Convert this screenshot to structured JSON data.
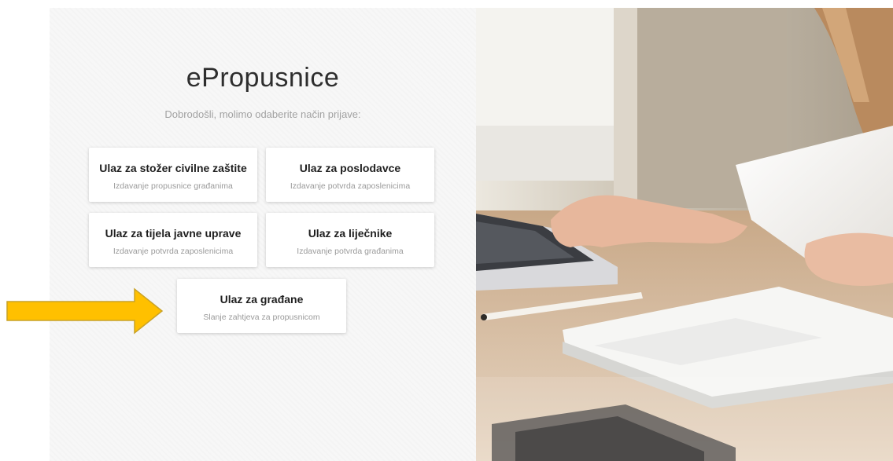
{
  "app": {
    "title": "ePropusnice",
    "subtitle": "Dobrodošli, molimo odaberite način prijave:"
  },
  "cards": [
    {
      "title": "Ulaz za stožer civilne zaštite",
      "subtitle": "Izdavanje propusnice građanima"
    },
    {
      "title": "Ulaz za poslodavce",
      "subtitle": "Izdavanje potvrda zaposlenicima"
    },
    {
      "title": "Ulaz za tijela javne uprave",
      "subtitle": "Izdavanje potvrda zaposlenicima"
    },
    {
      "title": "Ulaz za liječnike",
      "subtitle": "Izdavanje potvrda građanima"
    },
    {
      "title": "Ulaz za građane",
      "subtitle": "Slanje zahtjeva za propusnicom"
    }
  ],
  "annotation": {
    "arrow_color": "#FFC000",
    "arrow_outline": "#C9A227"
  },
  "photo": {
    "icon": "office-desk-laptop-photo"
  }
}
